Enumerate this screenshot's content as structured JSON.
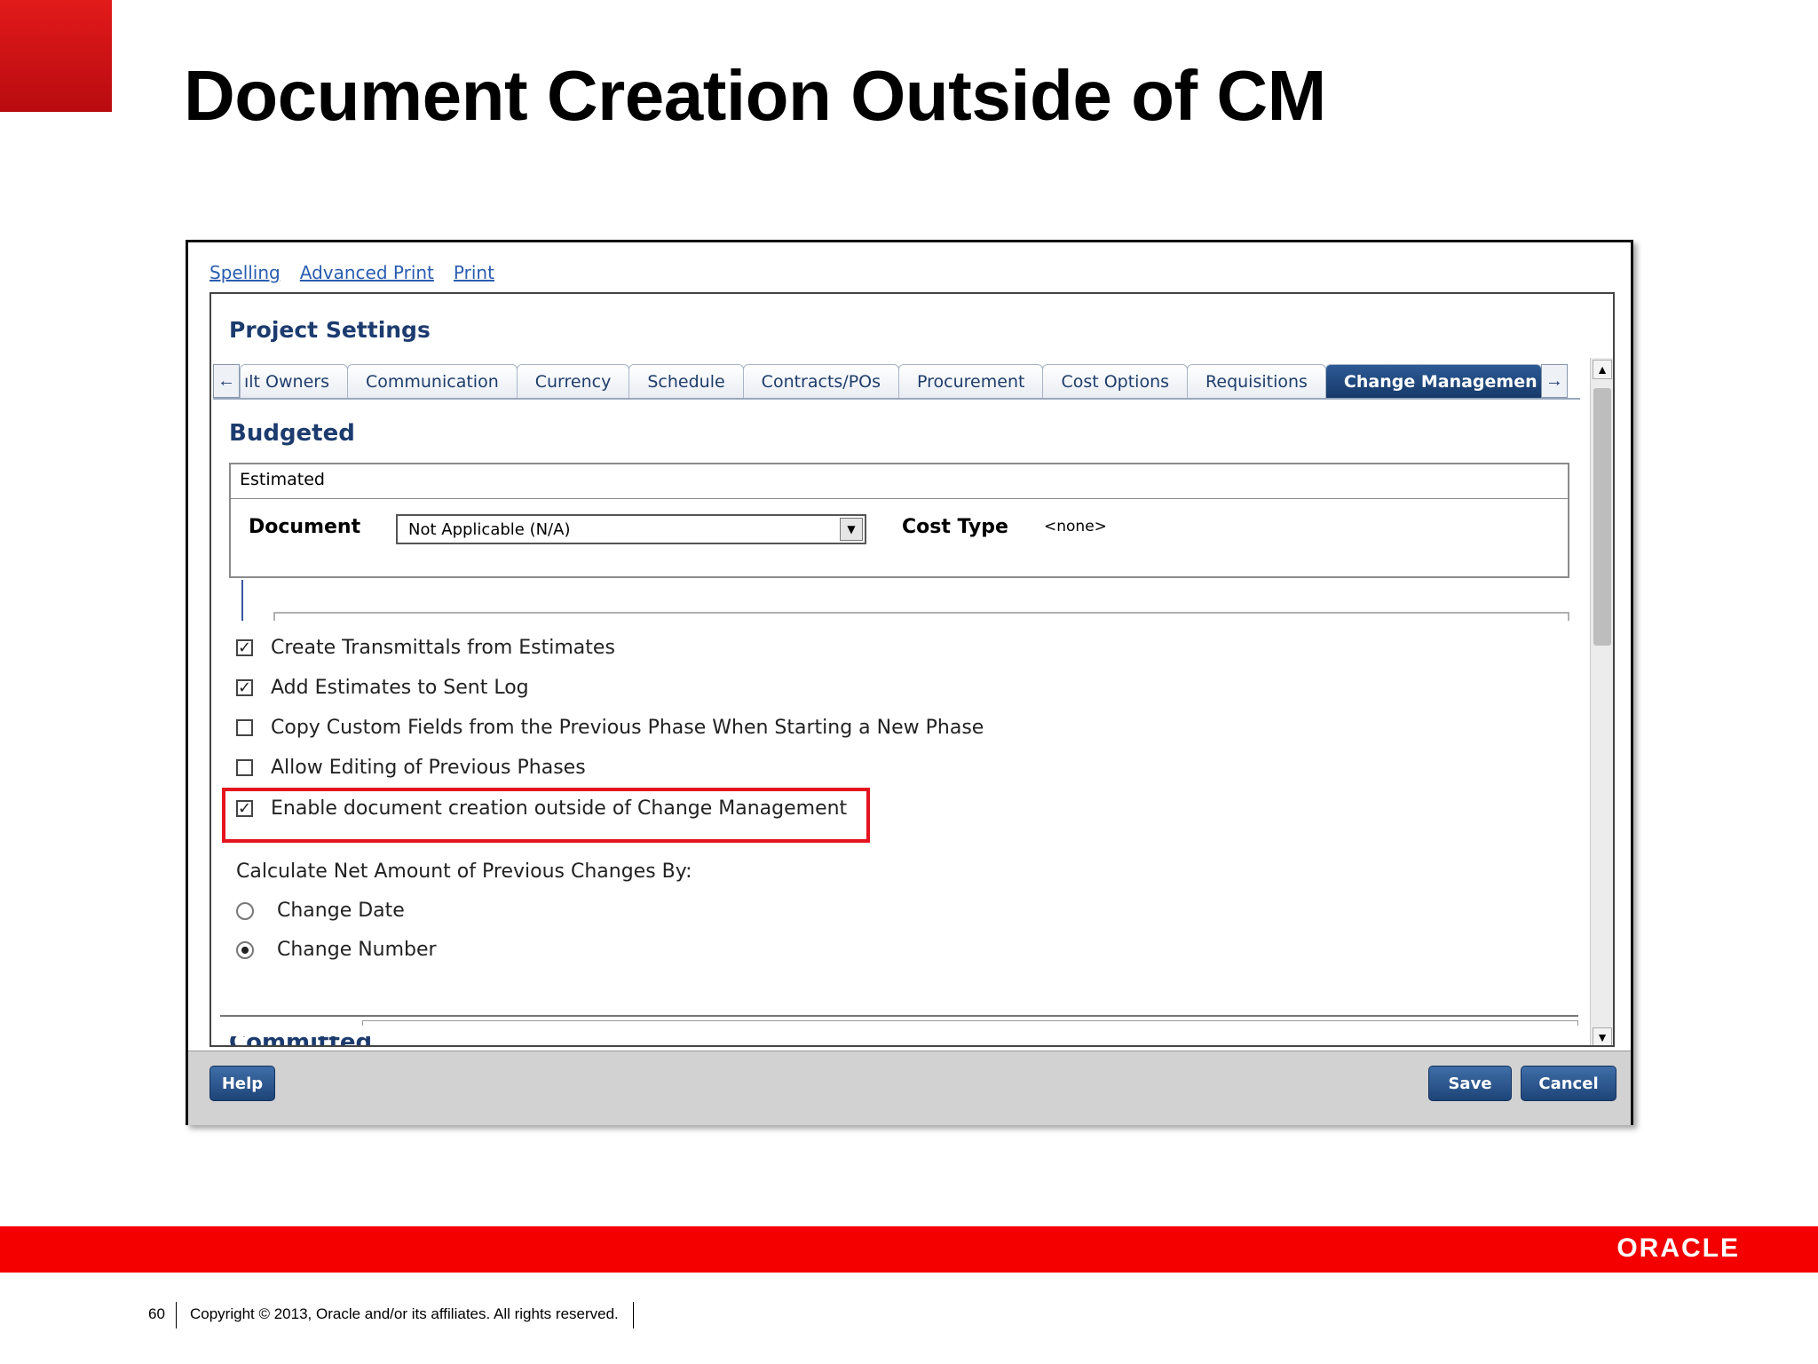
{
  "slide": {
    "title": "Document Creation Outside of CM",
    "page_number": "60",
    "copyright": "Copyright © 2013, Oracle and/or its affiliates. All rights reserved.",
    "brand": "ORACLE",
    "brand_color": "#f40000"
  },
  "toolbar": {
    "links": [
      "Spelling",
      "Advanced Print",
      "Print"
    ]
  },
  "panel": {
    "title": "Project Settings",
    "tabs": [
      "ılt Owners",
      "Communication",
      "Currency",
      "Schedule",
      "Contracts/POs",
      "Procurement",
      "Cost Options",
      "Requisitions",
      "Change Managemen"
    ],
    "active_tab": "Change Managemen",
    "section_title": "Budgeted",
    "estimated": {
      "legend": "Estimated",
      "document_label": "Document",
      "document_value": "Not Applicable (N/A)",
      "cost_type_label": "Cost Type",
      "cost_type_value": "<none>"
    },
    "options": [
      {
        "label": "Create Transmittals from Estimates",
        "checked": true
      },
      {
        "label": "Add Estimates to Sent Log",
        "checked": true
      },
      {
        "label": "Copy Custom Fields from the Previous Phase When Starting a New Phase",
        "checked": false
      },
      {
        "label": "Allow Editing of Previous Phases",
        "checked": false
      },
      {
        "label": "Enable document creation outside of Change Management",
        "checked": true,
        "highlighted": true
      }
    ],
    "calc_label": "Calculate Net Amount of Previous Changes By:",
    "radios": [
      {
        "label": "Change Date",
        "selected": false
      },
      {
        "label": "Change Number",
        "selected": true
      }
    ],
    "next_section": "Committed"
  },
  "buttons": {
    "help": "Help",
    "save": "Save",
    "cancel": "Cancel"
  },
  "icons": {
    "tab_left": "arrow-left-icon",
    "tab_right": "arrow-right-icon",
    "scroll_up": "scroll-up-icon",
    "scroll_down": "scroll-down-icon",
    "dropdown": "chevron-down-icon",
    "check": "check-icon"
  },
  "colors": {
    "highlight": "#e4151f",
    "header_blue": "#1c3b6e",
    "link_blue": "#2a5db0"
  }
}
